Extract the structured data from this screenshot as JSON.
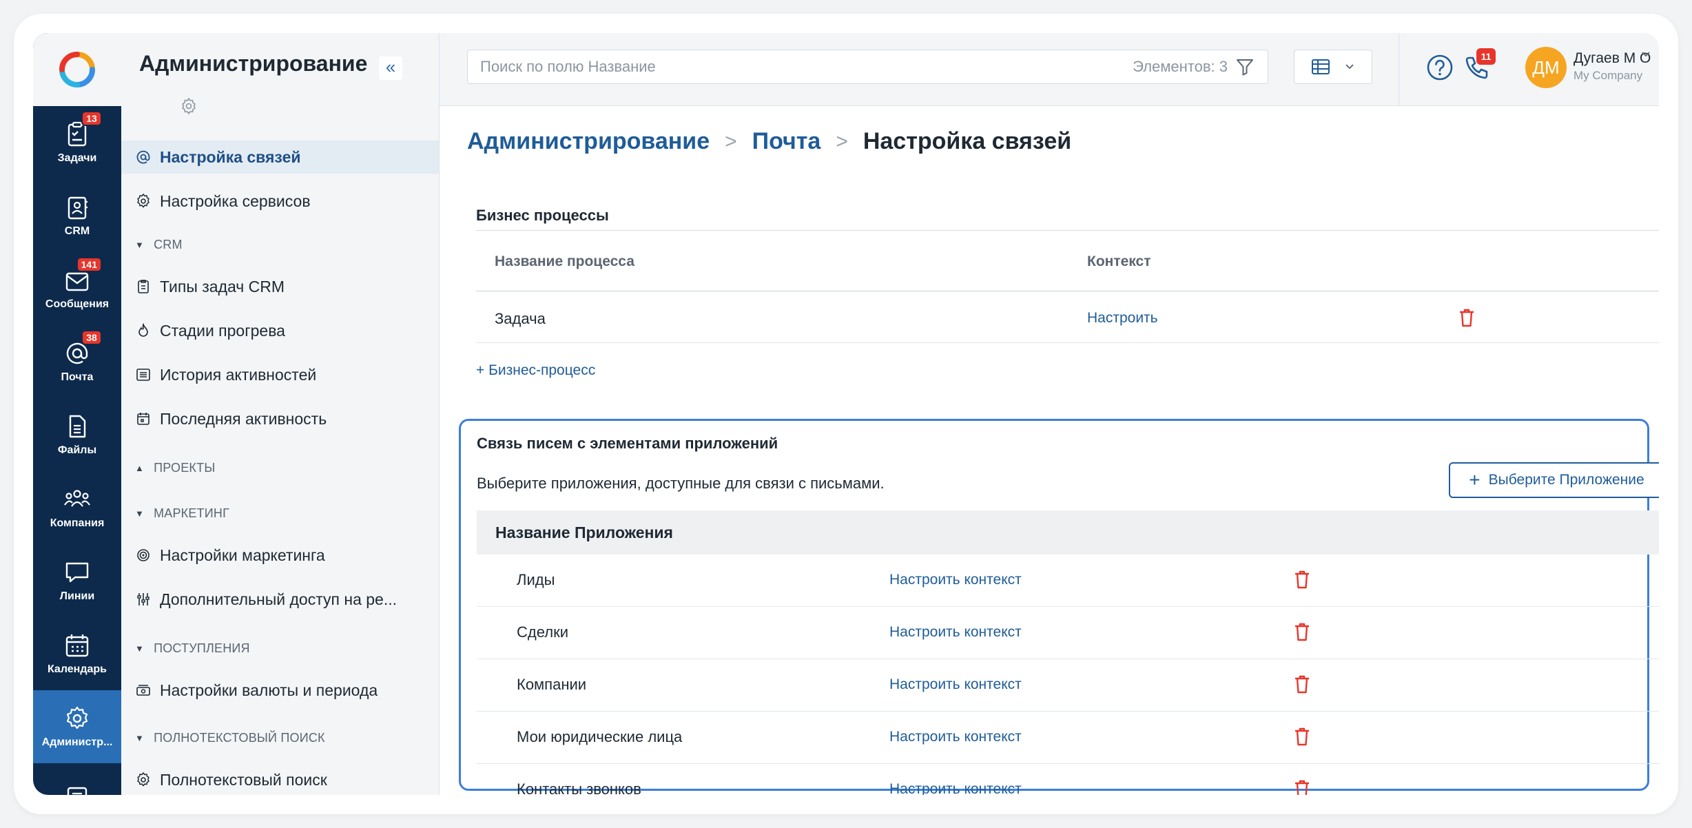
{
  "rail": {
    "items": [
      {
        "label": "Задачи",
        "icon": "tasks-icon",
        "badge": "13"
      },
      {
        "label": "CRM",
        "icon": "crm-icon",
        "badge": ""
      },
      {
        "label": "Сообщения",
        "icon": "messages-icon",
        "badge": "141"
      },
      {
        "label": "Почта",
        "icon": "mail-at-icon",
        "badge": "38"
      },
      {
        "label": "Файлы",
        "icon": "files-icon",
        "badge": ""
      },
      {
        "label": "Компания",
        "icon": "company-icon",
        "badge": ""
      },
      {
        "label": "Линии",
        "icon": "lines-icon",
        "badge": ""
      },
      {
        "label": "Календарь",
        "icon": "calendar-icon",
        "badge": ""
      },
      {
        "label": "Администр...",
        "icon": "admin-gear-icon",
        "badge": ""
      }
    ]
  },
  "sidebar": {
    "title": "Администрирование",
    "collapse_label": "«",
    "items": [
      {
        "label": "Настройка связей"
      },
      {
        "label": "Настройка сервисов"
      },
      {
        "label": "Типы задач CRM"
      },
      {
        "label": "Стадии прогрева"
      },
      {
        "label": "История активностей"
      },
      {
        "label": "Последняя активность"
      },
      {
        "label": "Настройки маркетинга"
      },
      {
        "label": "Дополнительный доступ на ре..."
      },
      {
        "label": "Настройки валюты и периода"
      },
      {
        "label": "Полнотекстовый поиск"
      }
    ],
    "sections": [
      {
        "label": "CRM",
        "caret": "▼"
      },
      {
        "label": "ПРОЕКТЫ",
        "caret": "▲"
      },
      {
        "label": "МАРКЕТИНГ",
        "caret": "▼"
      },
      {
        "label": "ПОСТУПЛЕНИЯ",
        "caret": "▼"
      },
      {
        "label": "ПОЛНОТЕКСТОВЫЙ ПОИСК",
        "caret": "▼"
      }
    ]
  },
  "topbar": {
    "search_placeholder": "Поиск по полю Название",
    "count_label": "Элементов: 3",
    "phone_badge": "11",
    "user_initials": "ДМ",
    "user_name": "Дугаев М О",
    "user_company": "My Company"
  },
  "breadcrumb": {
    "root": "Администрирование",
    "section": "Почта",
    "current": "Настройка связей",
    "separator": ">"
  },
  "business": {
    "title": "Бизнес процессы",
    "col_name": "Название процесса",
    "col_context": "Контекст",
    "rows": [
      {
        "name": "Задача",
        "link": "Настроить"
      }
    ],
    "add_label": "+ Бизнес-процесс"
  },
  "apps": {
    "title": "Связь писем с элементами приложений",
    "description": "Выберите приложения, доступные для связи с письмами.",
    "select_button": "Выберите Приложение",
    "column": "Название Приложения",
    "rows": [
      {
        "name": "Лиды",
        "link": "Настроить контекст"
      },
      {
        "name": "Сделки",
        "link": "Настроить контекст"
      },
      {
        "name": "Компании",
        "link": "Настроить контекст"
      },
      {
        "name": "Мои юридические лица",
        "link": "Настроить контекст"
      },
      {
        "name": "Контакты звонков",
        "link": "Настроить контекст"
      }
    ]
  },
  "colors": {
    "rail_bg": "#0d2a4d",
    "rail_active": "#2a6fb5",
    "link": "#1f5c99",
    "danger": "#e8352a",
    "highlight": "#3b7fd8",
    "avatar": "#f5a522"
  }
}
